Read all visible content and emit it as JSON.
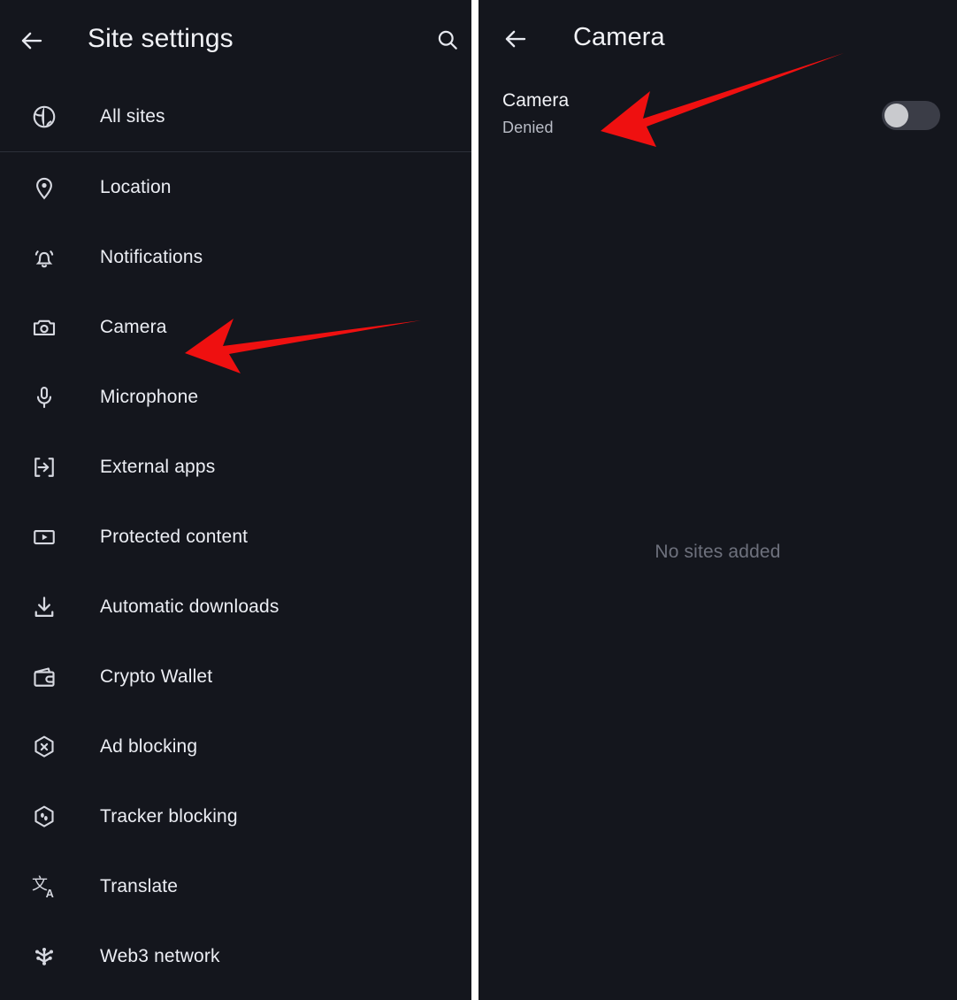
{
  "theme": {
    "background": "#14161d",
    "text_primary": "#eceef4",
    "text_secondary": "#b9bcc6",
    "text_muted": "#6e717d",
    "divider": "#2c2f39",
    "annotation_red": "#ef1010",
    "toggle_track_off": "#3b3d47",
    "toggle_thumb_off": "#c9cace"
  },
  "left_panel": {
    "appbar": {
      "back_icon": "arrow-left-icon",
      "title": "Site settings",
      "search_icon": "search-icon"
    },
    "top_items": [
      {
        "icon": "globe-icon",
        "label": "All sites"
      }
    ],
    "items": [
      {
        "icon": "location-pin-icon",
        "label": "Location"
      },
      {
        "icon": "bell-icon",
        "label": "Notifications"
      },
      {
        "icon": "camera-icon",
        "label": "Camera"
      },
      {
        "icon": "microphone-icon",
        "label": "Microphone"
      },
      {
        "icon": "external-apps-icon",
        "label": "External apps"
      },
      {
        "icon": "protected-content-icon",
        "label": "Protected content"
      },
      {
        "icon": "download-icon",
        "label": "Automatic downloads"
      },
      {
        "icon": "wallet-icon",
        "label": "Crypto Wallet"
      },
      {
        "icon": "ad-blocking-icon",
        "label": "Ad blocking"
      },
      {
        "icon": "tracker-blocking-icon",
        "label": "Tracker blocking"
      },
      {
        "icon": "translate-icon",
        "label": "Translate"
      },
      {
        "icon": "web3-network-icon",
        "label": "Web3 network"
      }
    ]
  },
  "right_panel": {
    "appbar": {
      "back_icon": "arrow-left-icon",
      "title": "Camera"
    },
    "permission": {
      "title": "Camera",
      "status": "Denied",
      "toggle_state": "off"
    },
    "empty_state": "No sites added"
  },
  "annotations": [
    {
      "name": "arrow-to-camera-menu-item",
      "color": "#ef1010",
      "points_to": "Camera"
    },
    {
      "name": "arrow-to-camera-permission",
      "color": "#ef1010",
      "points_to": "Camera / Denied"
    }
  ]
}
